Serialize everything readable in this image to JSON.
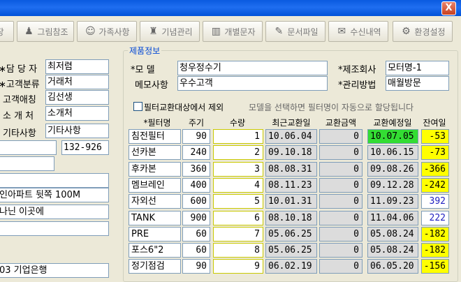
{
  "window": {
    "close_label": "X"
  },
  "toolbar": {
    "buttons": [
      {
        "label": "장",
        "icon": "partial-icon"
      },
      {
        "label": "그림참조",
        "icon": "person-pedestal-icon"
      },
      {
        "label": "가족사항",
        "icon": "family-icon"
      },
      {
        "label": "기념관리",
        "icon": "celebration-icon"
      },
      {
        "label": "개별문자",
        "icon": "mobile-phone-icon"
      },
      {
        "label": "문서파일",
        "icon": "document-icon"
      },
      {
        "label": "수신내역",
        "icon": "received-mail-icon"
      },
      {
        "label": "환경설정",
        "icon": "settings-icon"
      }
    ]
  },
  "customer": {
    "fields": [
      {
        "label": "담 당 자",
        "value": "최저렴"
      },
      {
        "label": "고객분류",
        "value": "거래처"
      },
      {
        "label": "고객애칭",
        "value": "김선생"
      },
      {
        "label": "소 개 처",
        "value": "소개처"
      },
      {
        "label": "기타사항",
        "value": "기타사항"
      }
    ],
    "postal_code": "132-926",
    "address1": "인아파트 뒷쪽 100M",
    "address2": "나닌 이곳에",
    "bank": "03 기업은행"
  },
  "product": {
    "group_title": "제품정보",
    "model_label": "*모        델",
    "model_value": "청우정수기",
    "maker_label": "*제조회사",
    "maker_value": "모터명-1",
    "memo_label": "메모사항",
    "memo_value": "우수고객",
    "mgmt_label": "*관리방법",
    "mgmt_value": "매월방문",
    "exclude_label": "필터교환대상에서 제외",
    "hint": "모델을 선택하면 필터명이 자동으로 할당됩니다"
  },
  "filter_table": {
    "headers": [
      "*필터명",
      "주기",
      "수량",
      "최근교환일",
      "교환금액",
      "교환예정일",
      "잔여일"
    ],
    "rows": [
      {
        "name": "침전필터",
        "cycle": "90",
        "qty": "1",
        "last": "10.06.04",
        "amount": "0",
        "next": "10.07.05",
        "remain": "-53"
      },
      {
        "name": "선카본",
        "cycle": "240",
        "qty": "2",
        "last": "09.10.18",
        "amount": "0",
        "next": "10.06.15",
        "remain": "-73"
      },
      {
        "name": "후카본",
        "cycle": "360",
        "qty": "3",
        "last": "08.08.31",
        "amount": "0",
        "next": "09.08.26",
        "remain": "-366"
      },
      {
        "name": "멤브레인",
        "cycle": "400",
        "qty": "4",
        "last": "08.11.23",
        "amount": "0",
        "next": "09.12.28",
        "remain": "-242"
      },
      {
        "name": "자외선",
        "cycle": "600",
        "qty": "5",
        "last": "10.01.31",
        "amount": "0",
        "next": "11.09.23",
        "remain": "392"
      },
      {
        "name": "TANK",
        "cycle": "900",
        "qty": "6",
        "last": "08.10.18",
        "amount": "0",
        "next": "11.04.06",
        "remain": "222"
      },
      {
        "name": "PRE",
        "cycle": "60",
        "qty": "7",
        "last": "05.06.25",
        "amount": "0",
        "next": "05.08.24",
        "remain": "-182"
      },
      {
        "name": "포스6\"2",
        "cycle": "60",
        "qty": "8",
        "last": "05.06.25",
        "amount": "0",
        "next": "05.08.24",
        "remain": "-182"
      },
      {
        "name": "정기점검",
        "cycle": "90",
        "qty": "9",
        "last": "06.02.19",
        "amount": "0",
        "next": "06.05.20",
        "remain": "-156"
      }
    ]
  },
  "colors": {
    "overdue_bg": "#ffff00",
    "ok_text": "#2020c0",
    "next_due_highlight": "#33dd33",
    "title_blue": "#0046d5"
  }
}
